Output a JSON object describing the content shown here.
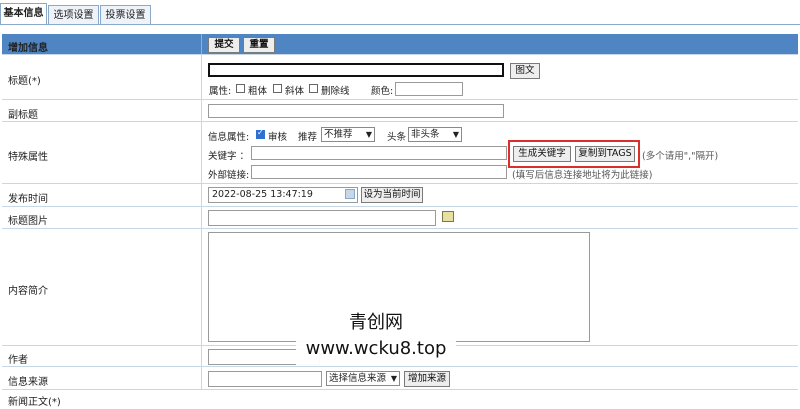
{
  "tabs": [
    {
      "label": "基本信息",
      "active": true
    },
    {
      "label": "选项设置",
      "active": false
    },
    {
      "label": "投票设置",
      "active": false
    }
  ],
  "header": {
    "title": "增加信息",
    "submit_label": "提交",
    "reset_label": "重置"
  },
  "title_row": {
    "label": "标题(*)",
    "title_value": "",
    "image_text_button": "图文",
    "attr_label": "属性:",
    "bold_label": "粗体",
    "italic_label": "斜体",
    "strike_label": "删除线",
    "color_label": "颜色:"
  },
  "subtitle_row": {
    "label": "副标题"
  },
  "special_row": {
    "label": "特殊属性",
    "info_attr_label": "信息属性:",
    "review_label": "审核",
    "review_checked": true,
    "recommend_label": "推荐",
    "recommend_value": "不推荐",
    "headline_label": "头条",
    "headline_value": "非头条",
    "keyword_label": "关键字 ：",
    "gen_keyword_button": "生成关键字",
    "copy_tags_button": "复制到TAGS",
    "keyword_hint": "(多个请用\",\"隔开)",
    "external_link_label": "外部链接:",
    "external_link_hint": "(填写后信息连接地址将为此链接)"
  },
  "publish_row": {
    "label": "发布时间",
    "datetime_value": "2022-08-25 13:47:19",
    "set_now_button": "设为当前时间"
  },
  "title_image_row": {
    "label": "标题图片"
  },
  "summary_row": {
    "label": "内容简介"
  },
  "author_row": {
    "label": "作者"
  },
  "source_row": {
    "label": "信息来源",
    "select_value": "选择信息来源",
    "add_source_button": "增加来源"
  },
  "content_row": {
    "label": "新闻正文(*)"
  },
  "watermark": {
    "line1": "青创网",
    "line2": "www.wcku8.top"
  },
  "colors": {
    "header_bg": "#4f85c2",
    "tab_border": "#8aa8c8",
    "highlight": "#d9302c"
  }
}
